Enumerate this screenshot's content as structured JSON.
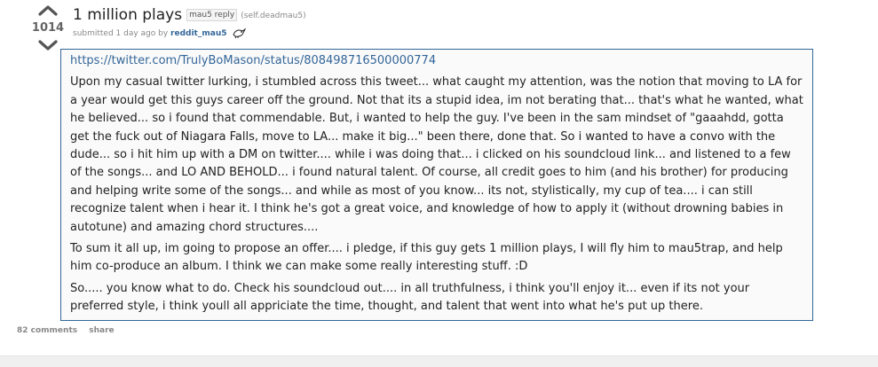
{
  "post": {
    "score": "1014",
    "title": "1 million plays",
    "flair": "mau5 reply",
    "domain": "(self.deadmau5)",
    "tagline_prefix": "submitted 1 day ago by ",
    "author": "reddit_mau5",
    "link": "https://twitter.com/TrulyBoMason/status/808498716500000774",
    "paragraphs": [
      "Upon my casual twitter lurking, i stumbled across this tweet... what caught my attention, was the notion that moving to LA for a year would get this guys career off the ground. Not that its a stupid idea, im not berating that... that's what he wanted, what he believed... so i found that commendable. But, i wanted to help the guy. I've been in the sam mindset of \"gaaahdd, gotta get the fuck out of Niagara Falls, move to LA... make it big...\" been there, done that. So i wanted to have a convo with the dude... so i hit him up with a DM on twitter.... while i was doing that... i clicked on his soundcloud link... and listened to a few of the songs... and LO AND BEHOLD... i found natural talent. Of course, all credit goes to him (and his brother) for producing and helping write some of the songs... and while as most of you know... its not, stylistically, my cup of tea.... i can still recognize talent when i hear it. I think he's got a great voice, and knowledge of how to apply it (without drowning babies in autotune) and amazing chord structures....",
      "To sum it all up, im going to propose an offer.... i pledge, if this guy gets 1 million plays, I will fly him to mau5trap, and help him co-produce an album. I think we can make some really interesting stuff. :D",
      "So..... you know what to do. Check his soundcloud out.... in all truthfulness, i think you'll enjoy it... even if its not your preferred style, i think youll all appriciate the time, thought, and talent that went into what he's put up there."
    ],
    "comments_label": "82 comments",
    "share_label": "share"
  },
  "icons": {
    "upvote": "upvote-arrow-icon",
    "downvote": "downvote-arrow-icon",
    "admin_badge": "bird-badge-icon"
  },
  "colors": {
    "link": "#336699",
    "vote_arrow": "#c6c6c6",
    "score": "#646464",
    "muted": "#888888"
  }
}
